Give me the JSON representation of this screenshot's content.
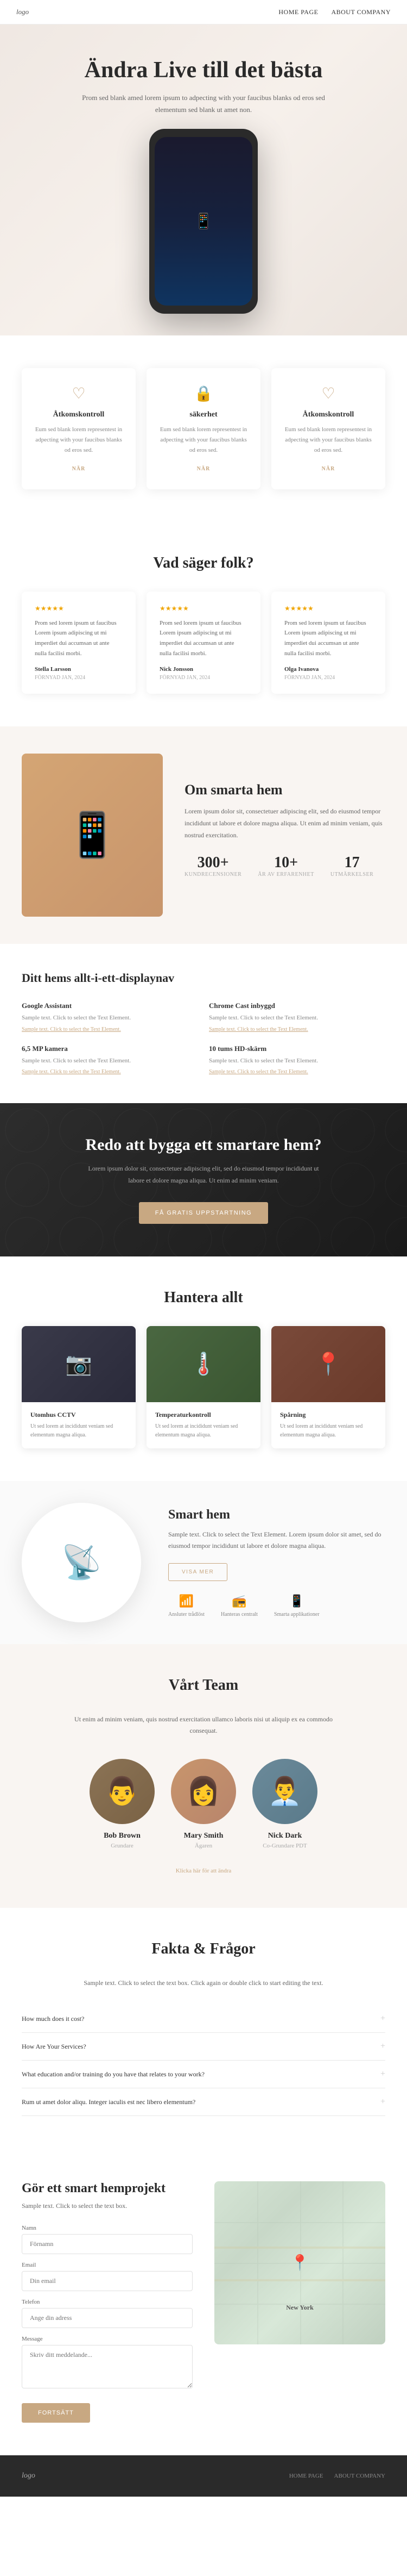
{
  "nav": {
    "logo": "logo",
    "links": [
      {
        "label": "HOME PAGE",
        "href": "#"
      },
      {
        "label": "ABOUT COMPANY",
        "href": "#"
      }
    ]
  },
  "hero": {
    "title": "Ändra Live till det bästa",
    "description": "Prom sed blank amed lorem ipsum to adpecting with your faucibus blanks od eros sed elementum sed blank ut amet non.",
    "phone_icon": "📱"
  },
  "feature_cards": {
    "title_display": false,
    "cards": [
      {
        "icon": "♡",
        "title": "Åtkomskontroll",
        "description": "Eum sed blank lorem representest in adpecting with your faucibus blanks od eros sed.",
        "link": "NÄR"
      },
      {
        "icon": "🔒",
        "title": "säkerhet",
        "description": "Eum sed blank lorem representest in adpecting with your faucibus blanks od eros sed.",
        "link": "NÄR"
      },
      {
        "icon": "♡",
        "title": "Åtkomskontroll",
        "description": "Eum sed blank lorem representest in adpecting with your faucibus blanks od eros sed.",
        "link": "NÄR"
      }
    ]
  },
  "testimonials": {
    "title": "Vad säger folk?",
    "items": [
      {
        "stars": "★★★★★",
        "text": "Prom sed lorem ipsum ut faucibus Lorem ipsum adipiscing ut mi imperdiet dui accumsan ut ante nulla facilisi morbi.",
        "author": "Stella Larsson",
        "date": "FÖRNYAD JAN, 2024"
      },
      {
        "stars": "★★★★★",
        "text": "Prom sed lorem ipsum ut faucibus Lorem ipsum adipiscing ut mi imperdiet dui accumsan ut ante nulla facilisi morbi.",
        "author": "Nick Jonsson",
        "date": "FÖRNYAD JAN, 2024"
      },
      {
        "stars": "★★★★★",
        "text": "Prom sed lorem ipsum ut faucibus Lorem ipsum adipiscing ut mi imperdiet dui accumsan ut ante nulla facilisi morbi.",
        "author": "Olga Ivanova",
        "date": "FÖRNYAD JAN, 2024"
      }
    ]
  },
  "smart_home": {
    "title": "Om smarta hem",
    "description": "Lorem ipsum dolor sit, consectetuer adipiscing elit, sed do eiusmod tempor incididunt ut labore et dolore magna aliqua. Ut enim ad minim veniam, quis nostrud exercitation.",
    "stats": [
      {
        "number": "300+",
        "label": "KUNDRECENSIONER"
      },
      {
        "number": "10+",
        "label": "ÅR AV ERFARENHET"
      },
      {
        "number": "17",
        "label": "UTMÄRKELSER"
      }
    ],
    "image_icon": "📱"
  },
  "display_nav": {
    "title": "Ditt hems allt-i-ett-displaynav",
    "items": [
      {
        "title": "Google Assistant",
        "description": "Sample text. Click to select the Text Element.",
        "link": "Sample text. Click to select the Text Element."
      },
      {
        "title": "Chrome Cast inbyggd",
        "description": "Sample text. Click to select the Text Element.",
        "link": "Sample text. Click to select the Text Element."
      },
      {
        "title": "6,5 MP kamera",
        "description": "Sample text. Click to select the Text Element.",
        "link": "Sample text. Click to select the Text Element."
      },
      {
        "title": "10 tums HD-skärm",
        "description": "Sample text. Click to select the Text Element.",
        "link": "Sample text. Click to select the Text Element."
      }
    ]
  },
  "cta": {
    "title": "Redo att bygga ett smartare hem?",
    "description": "Lorem ipsum dolor sit, consectetuer adipiscing elit, sed do eiusmod tempor incididunt ut labore et dolore magna aliqua. Ut enim ad minim veniam.",
    "button": "FÅ GRATIS UPPSTARTNING"
  },
  "manage": {
    "title": "Hantera allt",
    "items": [
      {
        "type": "cctv",
        "icon": "📷",
        "title": "Utomhus CCTV",
        "description": "Ut sed lorem at incididunt veniam sed elementum magna aliqua."
      },
      {
        "type": "temp",
        "icon": "🌡️",
        "title": "Temperaturkontroll",
        "description": "Ut sed lorem at incididunt veniam sed elementum magna aliqua."
      },
      {
        "type": "track",
        "icon": "📍",
        "title": "Spårning",
        "description": "Ut sed lorem at incididunt veniam sed elementum magna aliqua."
      }
    ]
  },
  "smart_product": {
    "title": "Smart hem",
    "description": "Sample text. Click to select the Text Element. Lorem ipsum dolor sit amet, sed do eiusmod tempor incididunt ut labore et dolore magna aliqua.",
    "button": "VISA MER",
    "icon": "📡",
    "features": [
      {
        "icon": "📶",
        "label": "Ansluter trådlöst"
      },
      {
        "icon": "📻",
        "label": "Hanteras centralt"
      },
      {
        "icon": "📱",
        "label": "Smarta applikationer"
      }
    ]
  },
  "team": {
    "title": "Vårt Team",
    "description": "Ut enim ad minim veniam, quis nostrud exercitation ullamco laboris nisi ut aliquip ex ea commodo consequat.",
    "members": [
      {
        "name": "Bob Brown",
        "role": "Grundare",
        "avatar_type": "bob",
        "avatar_icon": "👨"
      },
      {
        "name": "Mary Smith",
        "role": "Ägaren",
        "avatar_type": "mary",
        "avatar_icon": "👩"
      },
      {
        "name": "Nick Dark",
        "role": "Co-Grundare PDT",
        "avatar_type": "nick",
        "avatar_icon": "👨‍💼"
      }
    ],
    "link": "Klicka här för att ändra"
  },
  "faq": {
    "title": "Fakta & Frågor",
    "description": "Sample text. Click to select the text box. Click again or double click to start editing the text.",
    "items": [
      {
        "question": "How much does it cost?"
      },
      {
        "question": "How Are Your Services?"
      },
      {
        "question": "What education and/or training do you have that relates to your work?"
      },
      {
        "question": "Rum ut amet dolor aliqu. Integer iaculis est nec libero elementum?"
      }
    ]
  },
  "contact": {
    "title": "Gör ett smart hemprojekt",
    "description": "Sample text. Click to select the text box.",
    "form": {
      "name_label": "Namn",
      "name_placeholder": "Förnamn",
      "email_label": "Email",
      "email_placeholder": "Din email",
      "phone_label": "Telefon",
      "phone_placeholder": "Ange din adress",
      "message_label": "Message",
      "message_placeholder": "Skriv ditt meddelande...",
      "submit": "FORTSÄTT"
    },
    "map": {
      "city": "New York"
    }
  },
  "footer": {
    "logo": "logo",
    "links": [
      {
        "label": "HOME PAGE"
      },
      {
        "label": "ABOUT COMPANY"
      }
    ]
  }
}
